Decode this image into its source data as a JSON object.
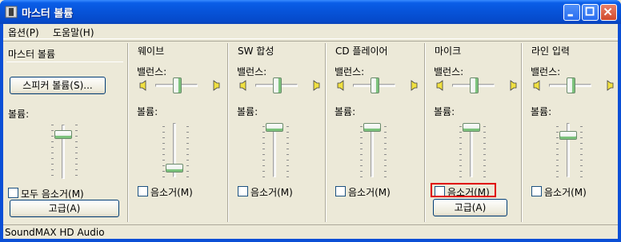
{
  "window": {
    "title": "마스터 볼륨"
  },
  "menu": {
    "options": "옵션(P)",
    "help": "도움말(H)"
  },
  "master": {
    "title": "마스터 볼륨",
    "speaker_button": "스피커 볼륨(S)...",
    "volume_label": "볼륨:",
    "mute_label": "모두 음소거(M)",
    "advanced_button": "고급(A)",
    "volume_level": 0.88
  },
  "channels": [
    {
      "title": "웨이브",
      "balance_label": "밸런스:",
      "volume_label": "볼륨:",
      "mute_label": "음소거(M)",
      "volume_level": 0.12,
      "balance": 0.5
    },
    {
      "title": "SW 합성",
      "balance_label": "밸런스:",
      "volume_label": "볼륨:",
      "mute_label": "음소거(M)",
      "volume_level": 1.0,
      "balance": 0.5
    },
    {
      "title": "CD 플레이어",
      "balance_label": "밸런스:",
      "volume_label": "볼륨:",
      "mute_label": "음소거(M)",
      "volume_level": 1.0,
      "balance": 0.5
    },
    {
      "title": "마이크",
      "balance_label": "밸런스:",
      "volume_label": "볼륨:",
      "mute_label": "음소거(M)",
      "volume_level": 1.0,
      "balance": 0.5,
      "advanced_button": "고급(A)"
    },
    {
      "title": "라인 입력",
      "balance_label": "밸런스:",
      "volume_label": "볼륨:",
      "mute_label": "음소거(M)",
      "volume_level": 0.82,
      "balance": 0.5
    }
  ],
  "status": {
    "text": "SoundMAX HD Audio"
  },
  "colors": {
    "title_bar": "#0753d8",
    "background": "#ece9d8",
    "highlight": "#e00000",
    "slider_accent": "#7bc27b"
  }
}
